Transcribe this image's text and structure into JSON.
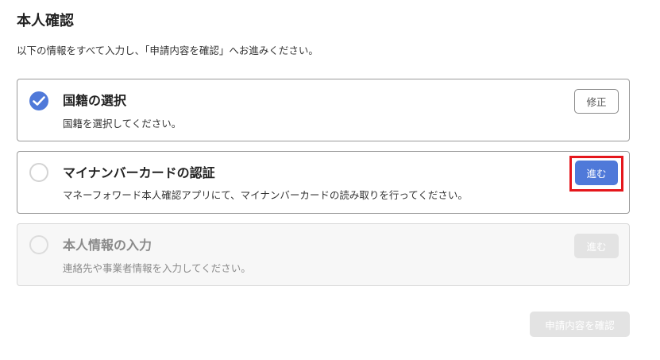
{
  "page": {
    "title": "本人確認",
    "description": "以下の情報をすべて入力し、「申請内容を確認」へお進みください。"
  },
  "steps": [
    {
      "title": "国籍の選択",
      "description": "国籍を選択してください。",
      "status": "completed",
      "button_label": "修正"
    },
    {
      "title": "マイナンバーカードの認証",
      "description": "マネーフォワード本人確認アプリにて、マイナンバーカードの読み取りを行ってください。",
      "status": "current",
      "button_label": "進む"
    },
    {
      "title": "本人情報の入力",
      "description": "連絡先や事業者情報を入力してください。",
      "status": "disabled",
      "button_label": "進む"
    }
  ],
  "footer": {
    "confirm_label": "申請内容を確認"
  },
  "colors": {
    "accent": "#4f79d9",
    "highlight": "#e5161b",
    "disabled": "#e3e3e3"
  }
}
